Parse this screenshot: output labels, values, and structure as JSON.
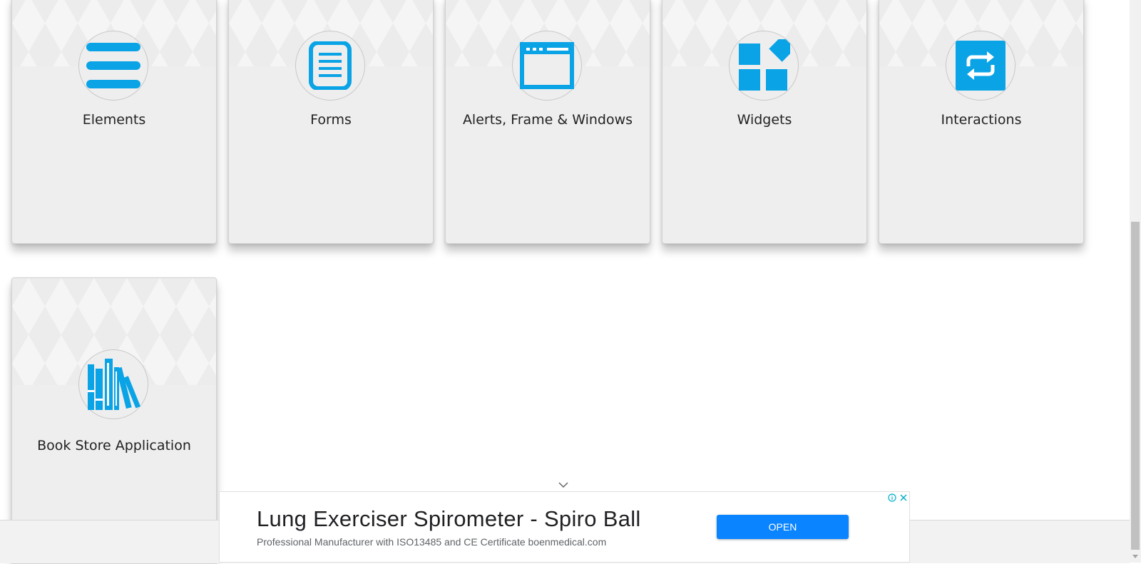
{
  "cards": [
    {
      "title": "Elements",
      "icon": "list-lines-icon"
    },
    {
      "title": "Forms",
      "icon": "document-form-icon"
    },
    {
      "title": "Alerts, Frame & Windows",
      "icon": "browser-window-icon"
    },
    {
      "title": "Widgets",
      "icon": "widgets-blocks-icon"
    },
    {
      "title": "Interactions",
      "icon": "repeat-arrows-icon"
    },
    {
      "title": "Book Store Application",
      "icon": "books-icon"
    }
  ],
  "ad": {
    "title": "Lung Exerciser Spirometer - Spiro Ball",
    "subtitle": "Professional Manufacturer with ISO13485 and CE Certificate boenmedical.com",
    "button": "OPEN",
    "info_icon": "info-icon",
    "close_icon": "close-icon",
    "collapse_icon": "chevron-down-icon"
  },
  "colors": {
    "accent": "#0aa3e6",
    "card_bg": "#eeeeee",
    "ad_button": "#0a84ff"
  }
}
